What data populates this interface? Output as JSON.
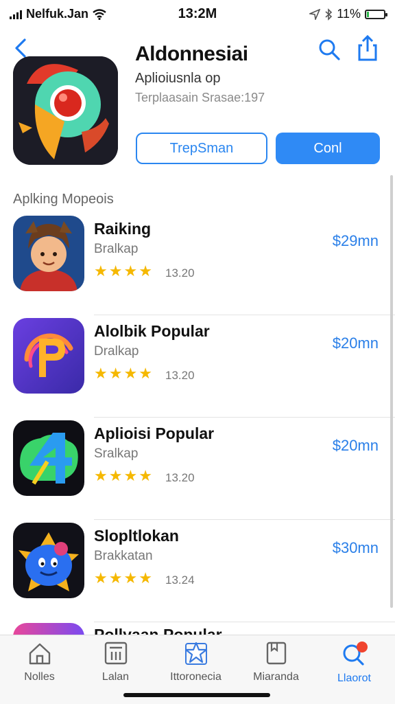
{
  "status_bar": {
    "carrier": "Nelfuk.Jan",
    "time": "13:2M",
    "battery": "11%",
    "battery_level": 0.11
  },
  "header": {
    "back_icon": "chevron-left-icon",
    "search_icon": "search-icon",
    "share_icon": "share-icon"
  },
  "app": {
    "title": "Aldonnesiai",
    "subtitle": "Aplioiusnla op",
    "meta": "Terplaasain Srasae:197",
    "secondary_button": "TrepSman",
    "primary_button": "Conl",
    "accent": "#2f8af5"
  },
  "section": {
    "title": "Aplking Mopeois"
  },
  "apps": [
    {
      "name": "Raiking",
      "category": "Bralkap",
      "stars": 4,
      "rating": "13.20",
      "price": "$29mn",
      "icon": "hero-character-icon"
    },
    {
      "name": "Alolbik Popular",
      "category": "Dralkap",
      "stars": 4,
      "rating": "13.20",
      "price": "$20mn",
      "icon": "p-logo-icon"
    },
    {
      "name": "Aplioisi Popular",
      "category": "Sralkap",
      "stars": 4,
      "rating": "13.20",
      "price": "$20mn",
      "icon": "number-four-icon"
    },
    {
      "name": "Slopltlokan",
      "category": "Brakkatan",
      "stars": 4,
      "rating": "13.24",
      "price": "$30mn",
      "icon": "blue-blob-character-icon"
    }
  ],
  "partial_row": {
    "name": "Pollyaan Popular"
  },
  "tabs": [
    {
      "label": "Nolles",
      "icon": "home-icon"
    },
    {
      "label": "Lalan",
      "icon": "list-icon"
    },
    {
      "label": "Ittoronecia",
      "icon": "star-icon"
    },
    {
      "label": "Miaranda",
      "icon": "bookmark-icon"
    },
    {
      "label": "Llaorot",
      "icon": "search-icon",
      "active": true
    }
  ]
}
